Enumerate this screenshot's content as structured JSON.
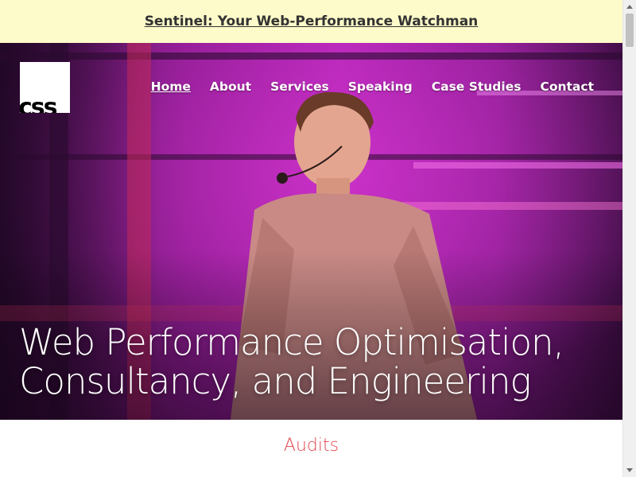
{
  "banner": {
    "link_text": "Sentinel: Your Web-Performance Watchman"
  },
  "logo": {
    "text": "css"
  },
  "nav": {
    "items": [
      {
        "label": "Home",
        "active": true
      },
      {
        "label": "About"
      },
      {
        "label": "Services"
      },
      {
        "label": "Speaking"
      },
      {
        "label": "Case Studies"
      },
      {
        "label": "Contact"
      }
    ]
  },
  "hero": {
    "title_line1": "Web Performance Optimisation,",
    "title_line2": "Consultancy, and Engineering"
  },
  "section": {
    "heading": "Audits"
  },
  "colors": {
    "banner_bg": "#fdfbc9",
    "accent_red": "#e0464f",
    "hero_magenta": "#b025b4"
  }
}
